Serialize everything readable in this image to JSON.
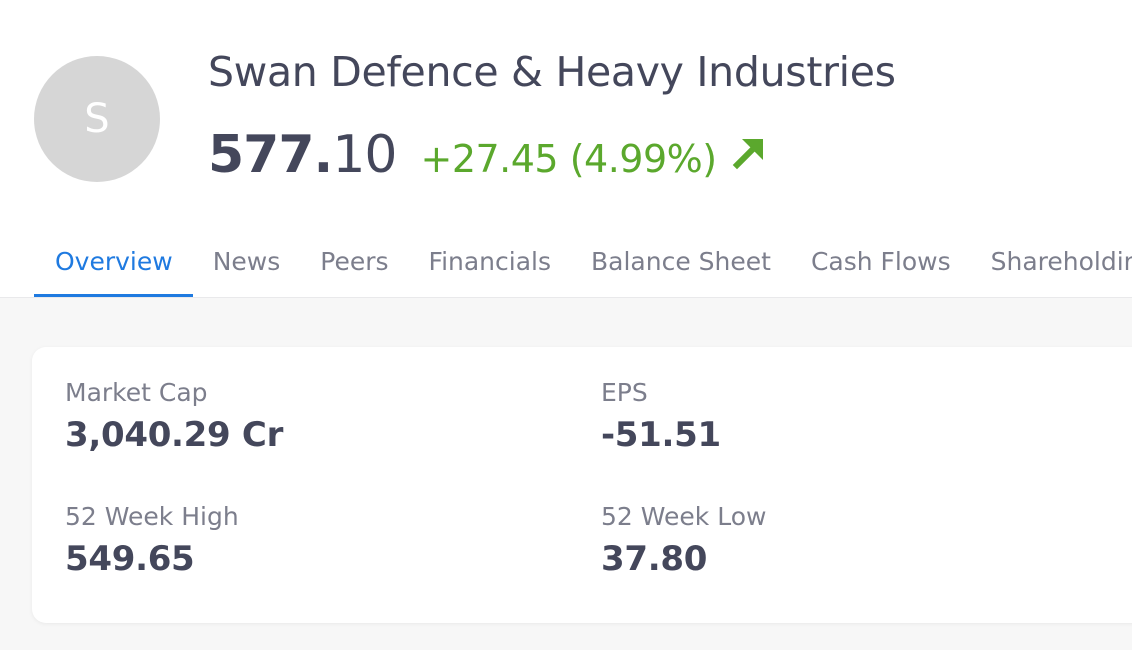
{
  "company": {
    "avatar_letter": "S",
    "name": "Swan Defence & Heavy Industries"
  },
  "quote": {
    "price_integer": "577.",
    "price_decimal": "10",
    "change": "+27.45 (4.99%)",
    "direction_icon": "arrow-up-right-icon",
    "change_color": "#5ba82d"
  },
  "tabs": [
    {
      "label": "Overview",
      "active": true
    },
    {
      "label": "News"
    },
    {
      "label": "Peers"
    },
    {
      "label": "Financials"
    },
    {
      "label": "Balance Sheet"
    },
    {
      "label": "Cash Flows"
    },
    {
      "label": "Shareholding"
    }
  ],
  "stats": {
    "market_cap": {
      "label": "Market Cap",
      "value": "3,040.29 Cr"
    },
    "eps": {
      "label": "EPS",
      "value": "-51.51"
    },
    "week52_high": {
      "label": "52 Week High",
      "value": "549.65"
    },
    "week52_low": {
      "label": "52 Week Low",
      "value": "37.80"
    }
  },
  "colors": {
    "accent": "#1f7ae0",
    "positive": "#5ba82d"
  }
}
